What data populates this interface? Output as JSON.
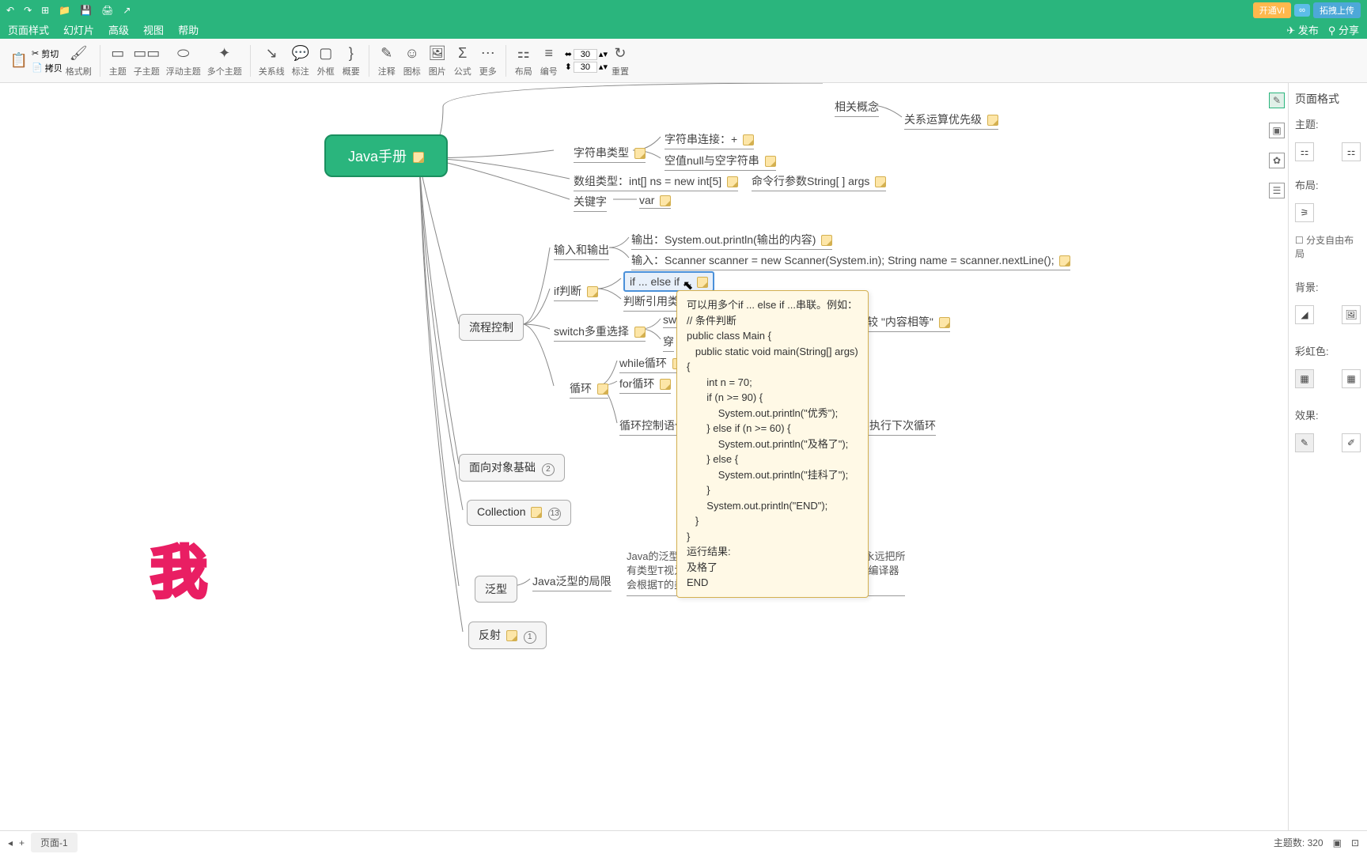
{
  "topbar": {
    "vip": "开通VI",
    "upload": "拓拽上传"
  },
  "menubar": {
    "items": [
      "页面样式",
      "幻灯片",
      "高级",
      "视图",
      "帮助"
    ],
    "publish": "发布",
    "share": "分享"
  },
  "toolbar": {
    "cut": "剪切",
    "paste": "拷贝",
    "format": "格式刷",
    "topic": "主题",
    "subtopic": "子主题",
    "floating": "浮动主题",
    "multi": "多个主题",
    "relation": "关系线",
    "label": "标注",
    "boundary": "外框",
    "summary": "概要",
    "note": "注释",
    "icon": "图标",
    "image": "图片",
    "formula": "公式",
    "more": "更多",
    "layout": "布局",
    "number": "编号",
    "spacing_h": "30",
    "spacing_v": "30",
    "reset": "重置"
  },
  "mindmap": {
    "root": "Java手册",
    "related_concept": "相关概念",
    "operator_precedence": "关系运算优先级",
    "string_type": "字符串类型",
    "string_concat": "字符串连接：+",
    "null_empty": "空值null与空字符串",
    "array_type": "数组类型：int[] ns = new int[5]",
    "cmdline_args": "命令行参数String[ ] args",
    "keyword": "关键字",
    "var": "var",
    "flow_control": "流程控制",
    "io": "输入和输出",
    "output": "输出：System.out.println(输出的内容)",
    "input": "输入：Scanner scanner = new Scanner(System.in);  String name = scanner.nextLine();",
    "if_branch": "if判断",
    "if_elseif": "if ... else if ...",
    "judge_ref": "判断引用类型",
    "switch": "switch多重选择",
    "sw": "sw",
    "fallthrough": "穿",
    "content_equal": "时，是比较 \"内容相等\"",
    "loop": "循环",
    "while_loop": "while循环",
    "for_loop": "for循环",
    "loop_control": "循环控制语句",
    "continue_desc": "直接继续执行下次循环",
    "oop_basic": "面向对象基础",
    "collection": "Collection",
    "generic": "泛型",
    "generic_limit": "Java泛型的局限",
    "generic_desc": "Java的泛型是由编译器在编译时实行的，编译器内部永远把所\n有类型T视为Object处理，但是，在需要转型的时候，编译器\n会根据T的类型自动为我们实行安全地强制转型。",
    "reflection": "反射"
  },
  "tooltip_text": "可以用多个if ... else if ...串联。例如：\n// 条件判断\npublic class Main {\n   public static void main(String[] args)\n{\n       int n = 70;\n       if (n >= 90) {\n           System.out.println(\"优秀\");\n       } else if (n >= 60) {\n           System.out.println(\"及格了\");\n       } else {\n           System.out.println(\"挂科了\");\n       }\n       System.out.println(\"END\");\n   }\n}\n运行结果:\n及格了\nEND",
  "watermark": "我",
  "sidebar": {
    "title": "页面格式",
    "theme": "主题:",
    "layout": "布局:",
    "free_layout": "分支自由布局",
    "background": "背景:",
    "rainbow": "彩虹色:",
    "effect": "效果:"
  },
  "statusbar": {
    "tab": "页面-1",
    "topic_count_label": "主题数:",
    "topic_count": "320"
  }
}
